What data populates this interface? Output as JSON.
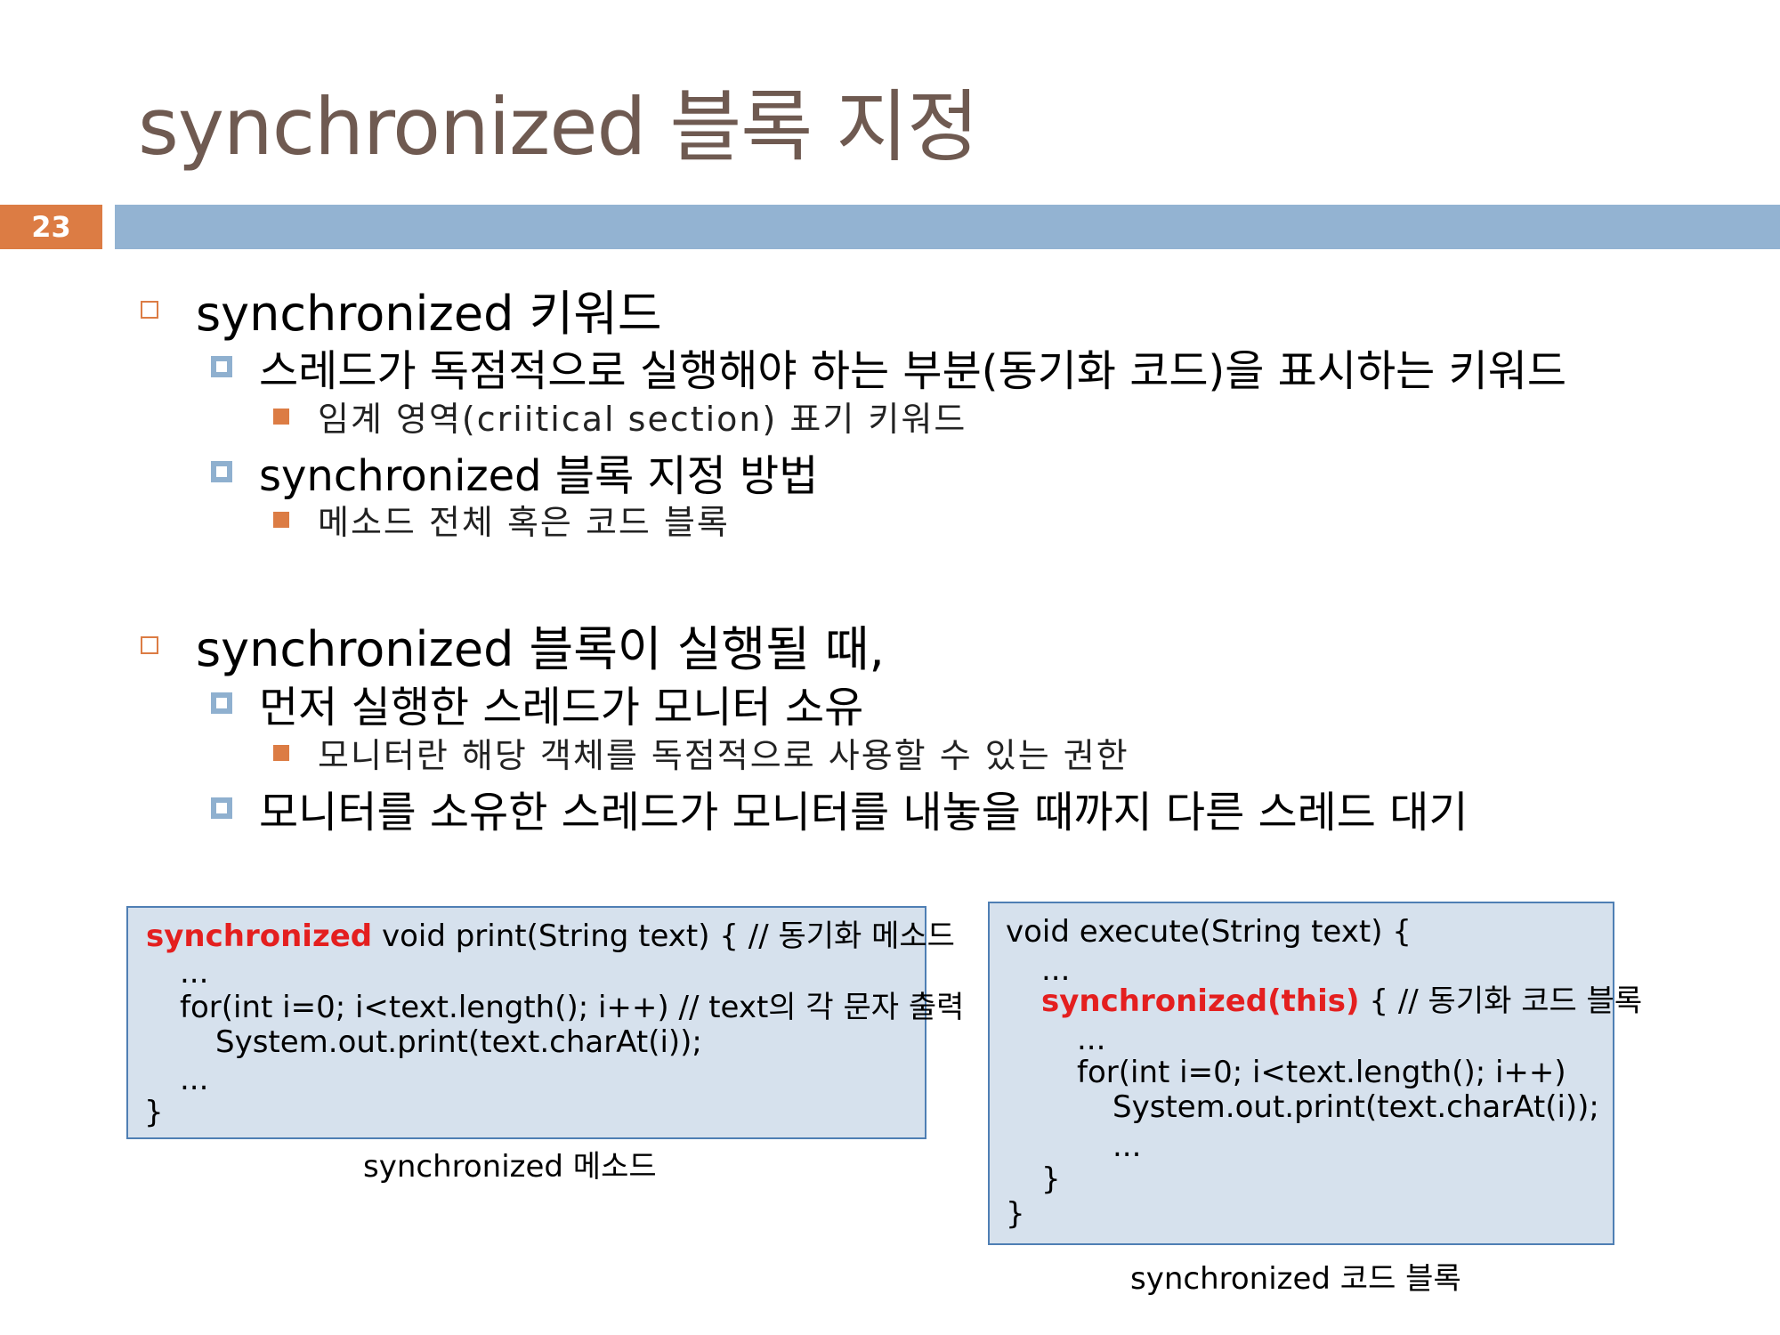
{
  "title": "synchronized 블록 지정",
  "page_number": "23",
  "bullets": {
    "s1": "synchronized 키워드",
    "s1_a": "스레드가 독점적으로 실행해야 하는 부분(동기화 코드)을 표시하는 키워드",
    "s1_a_1": "임계 영역(criitical section) 표기 키워드",
    "s1_b": "synchronized 블록 지정 방법",
    "s1_b_1": "메소드 전체 혹은 코드 블록",
    "s2": "synchronized 블록이 실행될 때,",
    "s2_a": "먼저 실행한 스레드가 모니터 소유",
    "s2_a_1": "모니터란 해당 객체를 독점적으로 사용할 수 있는 권한",
    "s2_b": "모니터를 소유한 스레드가 모니터를 내놓을 때까지 다른 스레드 대기"
  },
  "code_left": {
    "line1_kw": "synchronized",
    "line1_rest": " void print(String text) { // 동기화 메소드",
    "line2": "...",
    "line3": "for(int i=0; i<text.length(); i++) // text의 각 문자 출력",
    "line4": "System.out.print(text.charAt(i));",
    "line5": "...",
    "line6": "}",
    "caption": "synchronized 메소드"
  },
  "code_right": {
    "line1": "void execute(String text) {",
    "line2": "...",
    "line3_kw": "synchronized(this)",
    "line3_rest": " { // 동기화 코드 블록",
    "line4": "...",
    "line5": "for(int i=0; i<text.length(); i++)",
    "line6": "System.out.print(text.charAt(i));",
    "line7": "...",
    "line8": "}",
    "line9": "}",
    "caption": "synchronized  코드 블록"
  },
  "colors": {
    "title": "#6f5a51",
    "accent_orange": "#dc7c44",
    "accent_blue": "#93b3d2",
    "code_bg": "#d6e1ed",
    "code_border": "#4f7fb4",
    "keyword_red": "#e41f1f"
  }
}
